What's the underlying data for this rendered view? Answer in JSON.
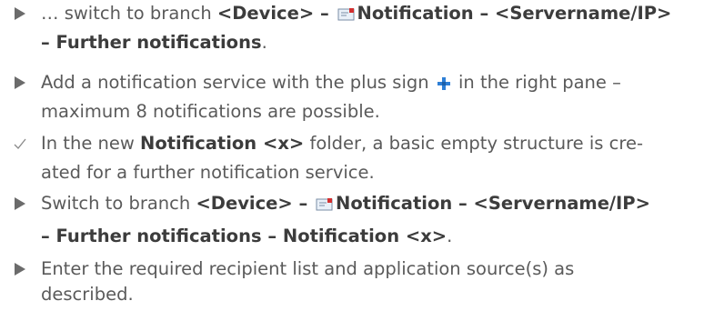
{
  "steps": [
    {
      "type": "action",
      "lines": [
        {
          "t1": "… switch to branch ",
          "t2": "<Device>",
          "t3": " – ",
          "t4": "Notification – <Servername/IP>"
        },
        {
          "t1": "– Further notifications",
          "t2": "."
        }
      ]
    },
    {
      "type": "action",
      "lines": [
        {
          "t1": "Add a notification service with the plus sign ",
          "t2": " in the right pane –"
        },
        {
          "t1": "maximum 8 notifications are possible."
        }
      ]
    },
    {
      "type": "result",
      "lines": [
        {
          "t1": "In the new ",
          "t2": "Notification <x>",
          "t3": " folder, a basic empty structure is cre-"
        },
        {
          "t1": "ated for a further notification service."
        }
      ]
    },
    {
      "type": "action",
      "lines": [
        {
          "t1": "Switch to branch ",
          "t2": "<Device>",
          "t3": " – ",
          "t4": "Notification – <Servername/IP>"
        },
        {
          "t1": "– Further notifications – Notification <x>",
          "t2": "."
        }
      ]
    },
    {
      "type": "action",
      "lines": [
        {
          "t1": "Enter the required recipient list and application source(s) as"
        },
        {
          "t1": "described."
        }
      ]
    }
  ],
  "icons": {
    "action_marker": "triangle-right-icon",
    "result_marker": "checkmark-icon",
    "notification": "mail-notification-icon",
    "add": "plus-icon"
  },
  "colors": {
    "text": "#5a5a5a",
    "bold": "#3c3c3c",
    "marker": "#6b6b6b",
    "plus": "#2e7fd6",
    "mail_accent": "#d32f2f"
  }
}
